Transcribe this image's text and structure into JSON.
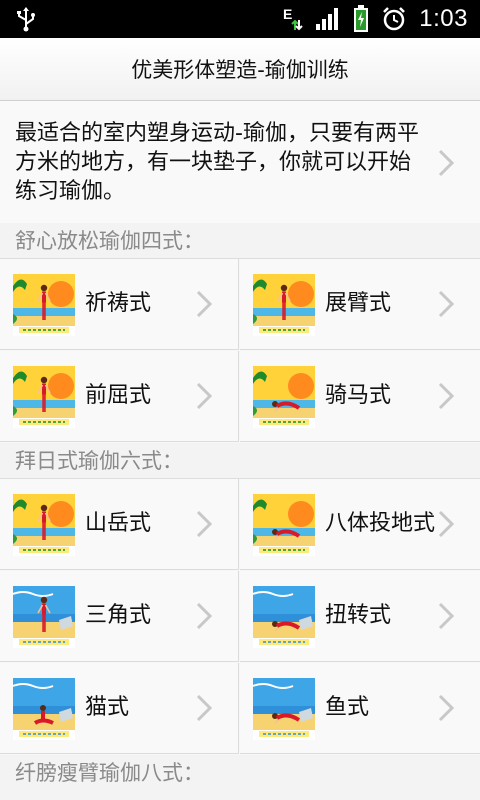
{
  "status_bar": {
    "time": "1:03",
    "icons": [
      "usb-icon",
      "data-e-icon",
      "signal-icon",
      "battery-charging-icon",
      "alarm-icon"
    ]
  },
  "title": "优美形体塑造-瑜伽训练",
  "intro": {
    "text": "最适合的室内塑身运动-瑜伽，只要有两平方米的地方，有一块垫子，你就可以开始练习瑜伽。"
  },
  "sections": [
    {
      "header": "舒心放松瑜伽四式：",
      "items": [
        {
          "label": "祈祷式",
          "thumb": "thumb-standing-sunset"
        },
        {
          "label": "展臂式",
          "thumb": "thumb-standing-sunset"
        },
        {
          "label": "前屈式",
          "thumb": "thumb-standing-sunset"
        },
        {
          "label": "骑马式",
          "thumb": "thumb-lying-sunset"
        }
      ]
    },
    {
      "header": "拜日式瑜伽六式：",
      "items": [
        {
          "label": "山岳式",
          "thumb": "thumb-standing-sunset"
        },
        {
          "label": "八体投地式",
          "thumb": "thumb-lying-sunset"
        },
        {
          "label": "三角式",
          "thumb": "thumb-standing-beach"
        },
        {
          "label": "扭转式",
          "thumb": "thumb-lying-beach"
        },
        {
          "label": "猫式",
          "thumb": "thumb-sitting-beach"
        },
        {
          "label": "鱼式",
          "thumb": "thumb-lying-beach"
        }
      ]
    },
    {
      "header": "纤膀瘦臂瑜伽八式：",
      "items": []
    }
  ],
  "colors": {
    "status_bg": "#000000",
    "header_text": "#8a8a8a",
    "sunset_sky": "#ffd23a",
    "beach_sky": "#3ea6e6",
    "sand": "#f6d370",
    "figure": "#d8192a"
  }
}
